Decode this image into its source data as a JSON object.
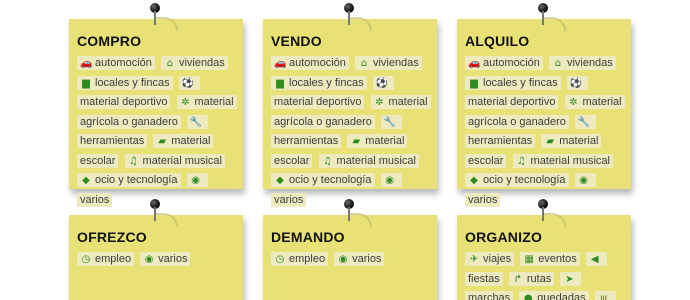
{
  "notes": {
    "compro": {
      "title": "COMPRO",
      "tags": [
        {
          "icon": "car-icon",
          "glyph": "🚗",
          "label": "automoción"
        },
        {
          "icon": "home-icon",
          "glyph": "⌂",
          "label": "viviendas"
        },
        {
          "icon": "building-icon",
          "glyph": "▆",
          "label": "locales y fincas"
        },
        {
          "icon": "soccer-ball-icon",
          "glyph": "⚽",
          "label": "material deportivo"
        },
        {
          "icon": "cog-icon",
          "glyph": "✲",
          "label": "material agrícola o ganadero"
        },
        {
          "icon": "wrench-icon",
          "glyph": "🔧",
          "label": "herramientas"
        },
        {
          "icon": "book-icon",
          "glyph": "▰",
          "label": "material escolar"
        },
        {
          "icon": "music-icon",
          "glyph": "♫",
          "label": "material musical"
        },
        {
          "icon": "tags-icon",
          "glyph": "◆",
          "label": "ocio y tecnología"
        },
        {
          "icon": "circle-dot-icon",
          "glyph": "◉",
          "label": "varios"
        }
      ]
    },
    "vendo": {
      "title": "VENDO",
      "tags": [
        {
          "icon": "car-icon",
          "glyph": "🚗",
          "label": "automoción"
        },
        {
          "icon": "home-icon",
          "glyph": "⌂",
          "label": "viviendas"
        },
        {
          "icon": "building-icon",
          "glyph": "▆",
          "label": "locales y fincas"
        },
        {
          "icon": "soccer-ball-icon",
          "glyph": "⚽",
          "label": "material deportivo"
        },
        {
          "icon": "cog-icon",
          "glyph": "✲",
          "label": "material agrícola o ganadero"
        },
        {
          "icon": "wrench-icon",
          "glyph": "🔧",
          "label": "herramientas"
        },
        {
          "icon": "book-icon",
          "glyph": "▰",
          "label": "material escolar"
        },
        {
          "icon": "music-icon",
          "glyph": "♫",
          "label": "material musical"
        },
        {
          "icon": "tags-icon",
          "glyph": "◆",
          "label": "ocio y tecnología"
        },
        {
          "icon": "circle-dot-icon",
          "glyph": "◉",
          "label": "varios"
        }
      ]
    },
    "alquilo": {
      "title": "ALQUILO",
      "tags": [
        {
          "icon": "car-icon",
          "glyph": "🚗",
          "label": "automoción"
        },
        {
          "icon": "home-icon",
          "glyph": "⌂",
          "label": "viviendas"
        },
        {
          "icon": "building-icon",
          "glyph": "▆",
          "label": "locales y fincas"
        },
        {
          "icon": "soccer-ball-icon",
          "glyph": "⚽",
          "label": "material deportivo"
        },
        {
          "icon": "cog-icon",
          "glyph": "✲",
          "label": "material agrícola o ganadero"
        },
        {
          "icon": "wrench-icon",
          "glyph": "🔧",
          "label": "herramientas"
        },
        {
          "icon": "book-icon",
          "glyph": "▰",
          "label": "material escolar"
        },
        {
          "icon": "music-icon",
          "glyph": "♫",
          "label": "material musical"
        },
        {
          "icon": "tags-icon",
          "glyph": "◆",
          "label": "ocio y tecnología"
        },
        {
          "icon": "circle-dot-icon",
          "glyph": "◉",
          "label": "varios"
        }
      ]
    },
    "ofrezco": {
      "title": "OFREZCO",
      "tags": [
        {
          "icon": "clock-icon",
          "glyph": "◷",
          "label": "empleo"
        },
        {
          "icon": "circle-dot-icon",
          "glyph": "◉",
          "label": "varios"
        }
      ]
    },
    "demando": {
      "title": "DEMANDO",
      "tags": [
        {
          "icon": "clock-icon",
          "glyph": "◷",
          "label": "empleo"
        },
        {
          "icon": "circle-dot-icon",
          "glyph": "◉",
          "label": "varios"
        }
      ]
    },
    "organizo": {
      "title": "ORGANIZO",
      "tags": [
        {
          "icon": "plane-icon",
          "glyph": "✈",
          "label": "viajes"
        },
        {
          "icon": "calendar-icon",
          "glyph": "▦",
          "label": "eventos"
        },
        {
          "icon": "speaker-icon",
          "glyph": "◀",
          "label": "fiestas"
        },
        {
          "icon": "route-icon",
          "glyph": "↱",
          "label": "rutas"
        },
        {
          "icon": "location-arrow-icon",
          "glyph": "➤",
          "label": "marchas"
        },
        {
          "icon": "group-icon",
          "glyph": "●",
          "label": "quedadas"
        },
        {
          "icon": "restaurant-icon",
          "glyph": "ψ",
          "label": ""
        }
      ]
    }
  },
  "colors": {
    "note": "#e8e176",
    "tag_bg": "#eeeac0",
    "icon": "#2e8b1e"
  }
}
